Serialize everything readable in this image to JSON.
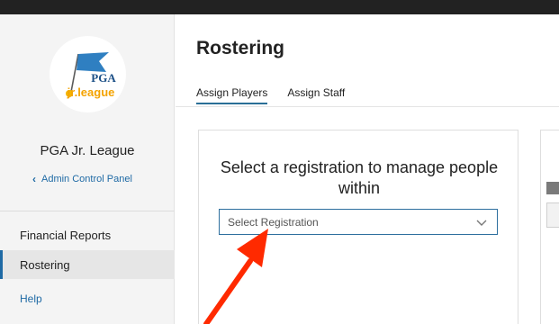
{
  "sidebar": {
    "logo": {
      "brand_text": "PGA",
      "sub_text": "jr.league"
    },
    "org_name": "PGA Jr. League",
    "admin_link": "Admin Control Panel",
    "nav_items": [
      {
        "label": "Financial Reports"
      },
      {
        "label": "Rostering",
        "active": true
      },
      {
        "label": "Help"
      }
    ]
  },
  "main": {
    "title": "Rostering",
    "tabs": [
      {
        "label": "Assign Players",
        "active": true
      },
      {
        "label": "Assign Staff"
      }
    ],
    "registration_card": {
      "heading": "Select a registration to manage people within",
      "select_placeholder": "Select Registration"
    }
  },
  "colors": {
    "accent": "#1f6aa5",
    "annotation_arrow": "#ff2a00",
    "topbar": "#222222"
  }
}
